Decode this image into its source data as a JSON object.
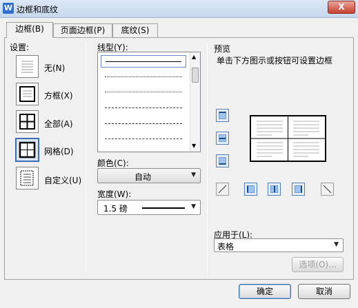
{
  "window": {
    "title": "边框和底纹",
    "app_icon": "W",
    "close_label": "X"
  },
  "tabs": [
    {
      "label": "边框(B)",
      "active": true
    },
    {
      "label": "页面边框(P)",
      "active": false
    },
    {
      "label": "底纹(S)",
      "active": false
    }
  ],
  "settings": {
    "heading": "设置:",
    "items": [
      {
        "label": "无(N)",
        "icon": "none-border-icon"
      },
      {
        "label": "方框(X)",
        "icon": "box-border-icon"
      },
      {
        "label": "全部(A)",
        "icon": "all-border-icon"
      },
      {
        "label": "网格(D)",
        "icon": "grid-border-icon",
        "selected": true
      },
      {
        "label": "自定义(U)",
        "icon": "custom-border-icon"
      }
    ]
  },
  "line_style": {
    "heading": "线型(Y):",
    "options": [
      "solid",
      "dotted",
      "dotted-fine",
      "dashed",
      "dash-dot",
      "dash-dot-dot",
      "long-dash"
    ],
    "selected_index": 0
  },
  "color": {
    "label": "颜色(C):",
    "value": "自动"
  },
  "width": {
    "label": "宽度(W):",
    "value": "1.5 磅"
  },
  "preview": {
    "heading": "预览",
    "hint": "单击下方图示或按钮可设置边框"
  },
  "apply_to": {
    "label": "应用于(L):",
    "value": "表格"
  },
  "buttons": {
    "options": "选项(O)...",
    "ok": "确定",
    "cancel": "取消"
  },
  "colors": {
    "accent": "#3b6db5",
    "title_bar": "#c7d8ee",
    "close": "#c7402f"
  }
}
